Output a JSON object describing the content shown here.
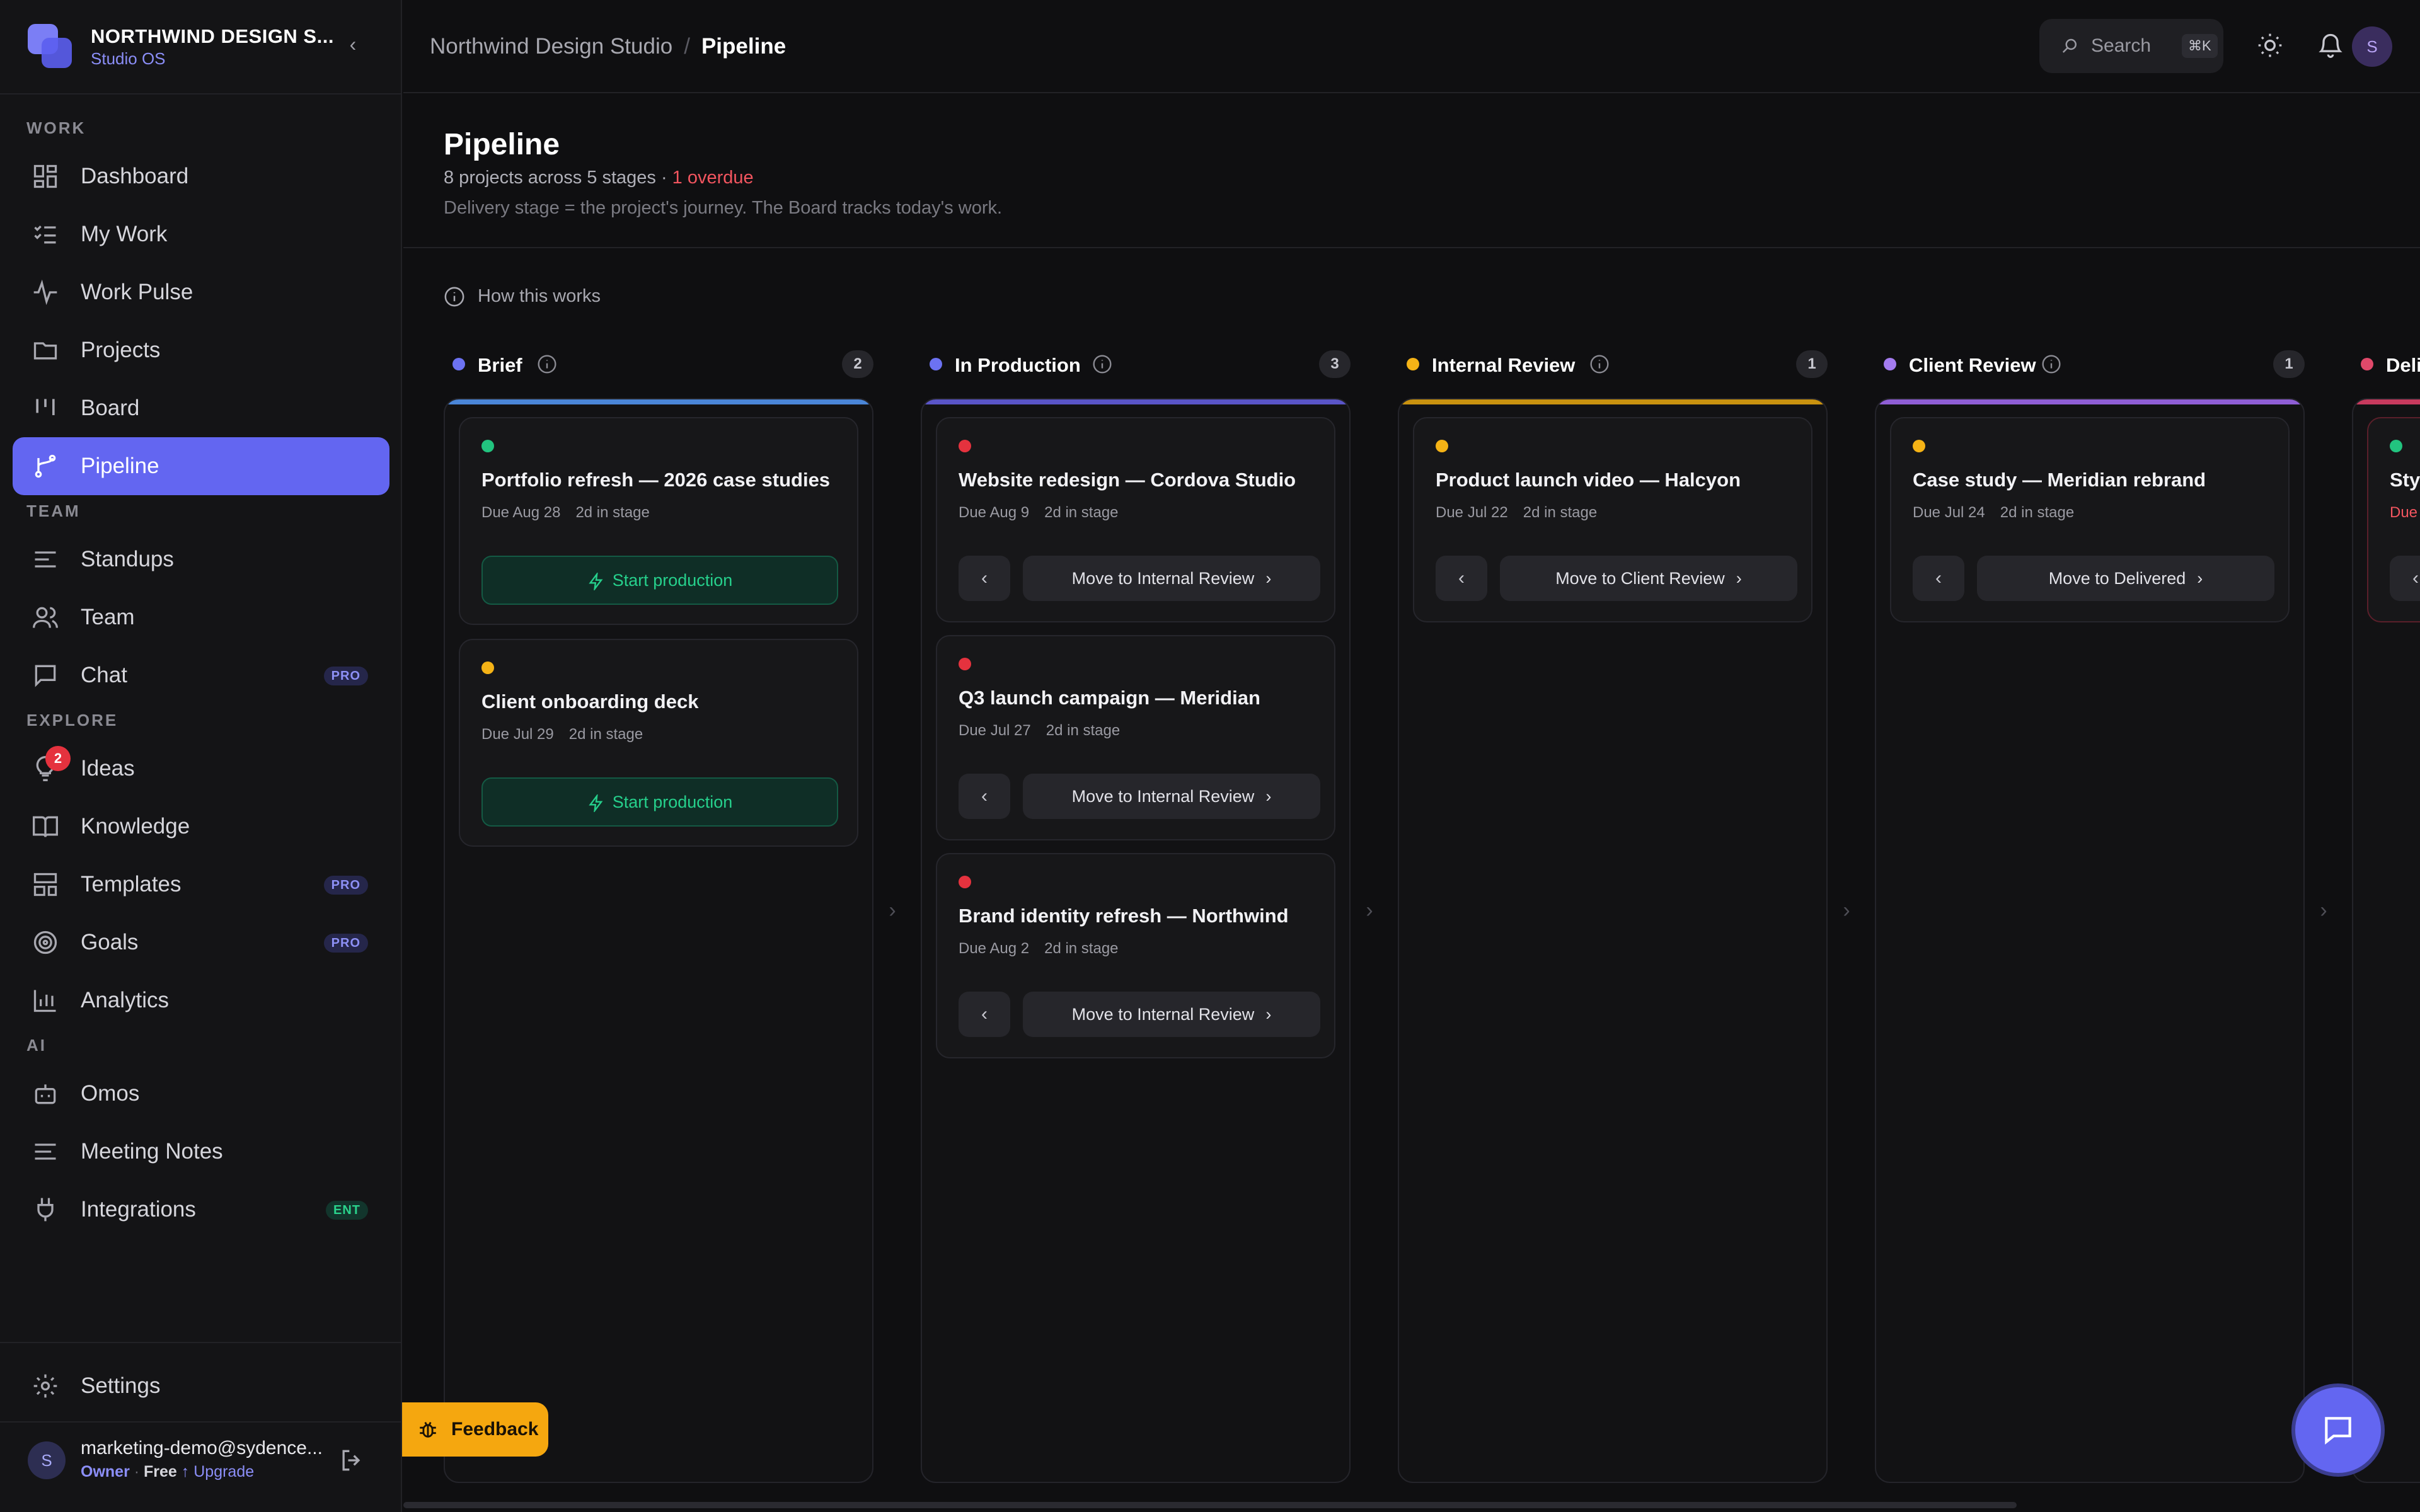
{
  "brand": {
    "name": "NORTHWIND DESIGN S...",
    "sub": "Studio OS",
    "color": "#6366f1"
  },
  "sidebar": {
    "sections": [
      {
        "label": "WORK",
        "items": [
          {
            "label": "Dashboard",
            "icon": "dashboard-icon"
          },
          {
            "label": "My Work",
            "icon": "checklist-icon"
          },
          {
            "label": "Work Pulse",
            "icon": "pulse-icon"
          },
          {
            "label": "Projects",
            "icon": "folder-icon"
          },
          {
            "label": "Board",
            "icon": "board-icon"
          },
          {
            "label": "Pipeline",
            "icon": "pipeline-icon",
            "active": true
          }
        ]
      },
      {
        "label": "TEAM",
        "items": [
          {
            "label": "Standups",
            "icon": "lines-icon"
          },
          {
            "label": "Team",
            "icon": "users-icon"
          },
          {
            "label": "Chat",
            "icon": "chat-icon",
            "badge": "PRO"
          }
        ]
      },
      {
        "label": "EXPLORE",
        "items": [
          {
            "label": "Ideas",
            "icon": "lightbulb-icon",
            "notification": "2"
          },
          {
            "label": "Knowledge",
            "icon": "book-icon"
          },
          {
            "label": "Templates",
            "icon": "template-icon",
            "badge": "PRO"
          },
          {
            "label": "Goals",
            "icon": "target-icon",
            "badge": "PRO"
          },
          {
            "label": "Analytics",
            "icon": "bar-chart-icon"
          }
        ]
      },
      {
        "label": "AI",
        "items": [
          {
            "label": "Omos",
            "icon": "bot-icon"
          },
          {
            "label": "Meeting Notes",
            "icon": "notes-icon"
          },
          {
            "label": "Integrations",
            "icon": "plug-icon",
            "badge": "ENT"
          }
        ]
      }
    ],
    "settings": "Settings",
    "user": {
      "initial": "S",
      "email": "marketing-demo@sydence...",
      "role": "Owner",
      "sep": "·",
      "plan": "Free",
      "upgrade": "↑ Upgrade"
    }
  },
  "topbar": {
    "breadcrumb": {
      "parent": "Northwind Design Studio",
      "slash": "/",
      "current": "Pipeline"
    },
    "search": {
      "label": "Search",
      "shortcut": "⌘K"
    },
    "avatar": "S"
  },
  "header": {
    "title": "Pipeline",
    "subtitle": "8 projects across 5 stages · ",
    "overdue": "1 overdue",
    "description": "Delivery stage = the project's journey. The Board tracks today's work."
  },
  "how_it_works": "How this works",
  "columns": [
    {
      "title": "Brief",
      "count": "2",
      "dot": "#6c72f2",
      "stripe": "#4a86d8",
      "cards": [
        {
          "dot": "#22c47f",
          "title": "Portfolio refresh — 2026 case studies",
          "due": "Due Aug 28",
          "stage": "2d in stage",
          "action": "Start production"
        },
        {
          "dot": "#f5b316",
          "title": "Client onboarding deck",
          "due": "Due Jul 29",
          "stage": "2d in stage",
          "action": "Start production"
        }
      ]
    },
    {
      "title": "In Production",
      "count": "3",
      "dot": "#6c72f2",
      "stripe": "#5a55c8",
      "cards": [
        {
          "dot": "#e5323e",
          "title": "Website redesign — Cordova Studio",
          "due": "Due Aug 9",
          "stage": "2d in stage",
          "action": "Move to Internal Review"
        },
        {
          "dot": "#e5323e",
          "title": "Q3 launch campaign — Meridian",
          "due": "Due Jul 27",
          "stage": "2d in stage",
          "action": "Move to Internal Review"
        },
        {
          "dot": "#e5323e",
          "title": "Brand identity refresh — Northwind",
          "due": "Due Aug 2",
          "stage": "2d in stage",
          "action": "Move to Internal Review"
        }
      ]
    },
    {
      "title": "Internal Review",
      "count": "1",
      "dot": "#f5b316",
      "stripe": "#c9920f",
      "cards": [
        {
          "dot": "#f5b316",
          "title": "Product launch video — Halcyon",
          "due": "Due Jul 22",
          "stage": "2d in stage",
          "action": "Move to Client Review"
        }
      ]
    },
    {
      "title": "Client Review",
      "count": "1",
      "dot": "#a47cf0",
      "stripe": "#8f5ed6",
      "cards": [
        {
          "dot": "#f5b316",
          "title": "Case study — Meridian rebrand",
          "due": "Due Jul 24",
          "stage": "2d in stage",
          "action": "Move to Delivered"
        }
      ]
    },
    {
      "title": "Deli",
      "count": "",
      "dot": "#e0496a",
      "stripe": "#c83a5e",
      "cards": [
        {
          "dot": "#22c47f",
          "title": "Styl",
          "due": "Due",
          "stage": "",
          "action": ""
        }
      ]
    }
  ],
  "feedback": "Feedback",
  "back_glyph": "‹",
  "next_glyph": "›",
  "collapse_glyph": "‹"
}
